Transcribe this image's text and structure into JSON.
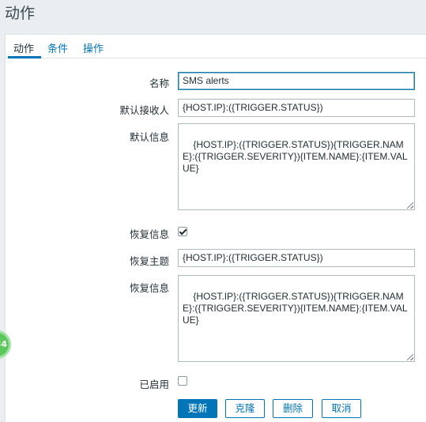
{
  "page": {
    "title": "动作"
  },
  "tabs": [
    {
      "label": "动作"
    },
    {
      "label": "条件"
    },
    {
      "label": "操作"
    }
  ],
  "form": {
    "name": {
      "label": "名称",
      "value": "SMS alerts"
    },
    "default_recipient": {
      "label": "默认接收人",
      "value": "{HOST.IP}:({TRIGGER.STATUS})"
    },
    "default_message": {
      "label": "默认信息",
      "value": "{HOST.IP}:({TRIGGER.STATUS}){TRIGGER.NAME}:({TRIGGER.SEVERITY}){ITEM.NAME}:{ITEM.VALUE}"
    },
    "recovery_message_enabled": {
      "label": "恢复信息",
      "checked": true
    },
    "recovery_subject": {
      "label": "恢复主题",
      "value": "{HOST.IP}:({TRIGGER.STATUS})"
    },
    "recovery_message": {
      "label": "恢复信息",
      "value": "{HOST.IP}:({TRIGGER.STATUS}){TRIGGER.NAME}:({TRIGGER.SEVERITY}){ITEM.NAME}:{ITEM.VALUE}"
    },
    "enabled": {
      "label": "已启用",
      "checked": false
    }
  },
  "buttons": {
    "update": "更新",
    "clone": "克隆",
    "delete": "删除",
    "cancel": "取消"
  },
  "side_badge": {
    "text": "34"
  },
  "colors": {
    "accent": "#0275b8",
    "badge": "#5cc85c"
  }
}
